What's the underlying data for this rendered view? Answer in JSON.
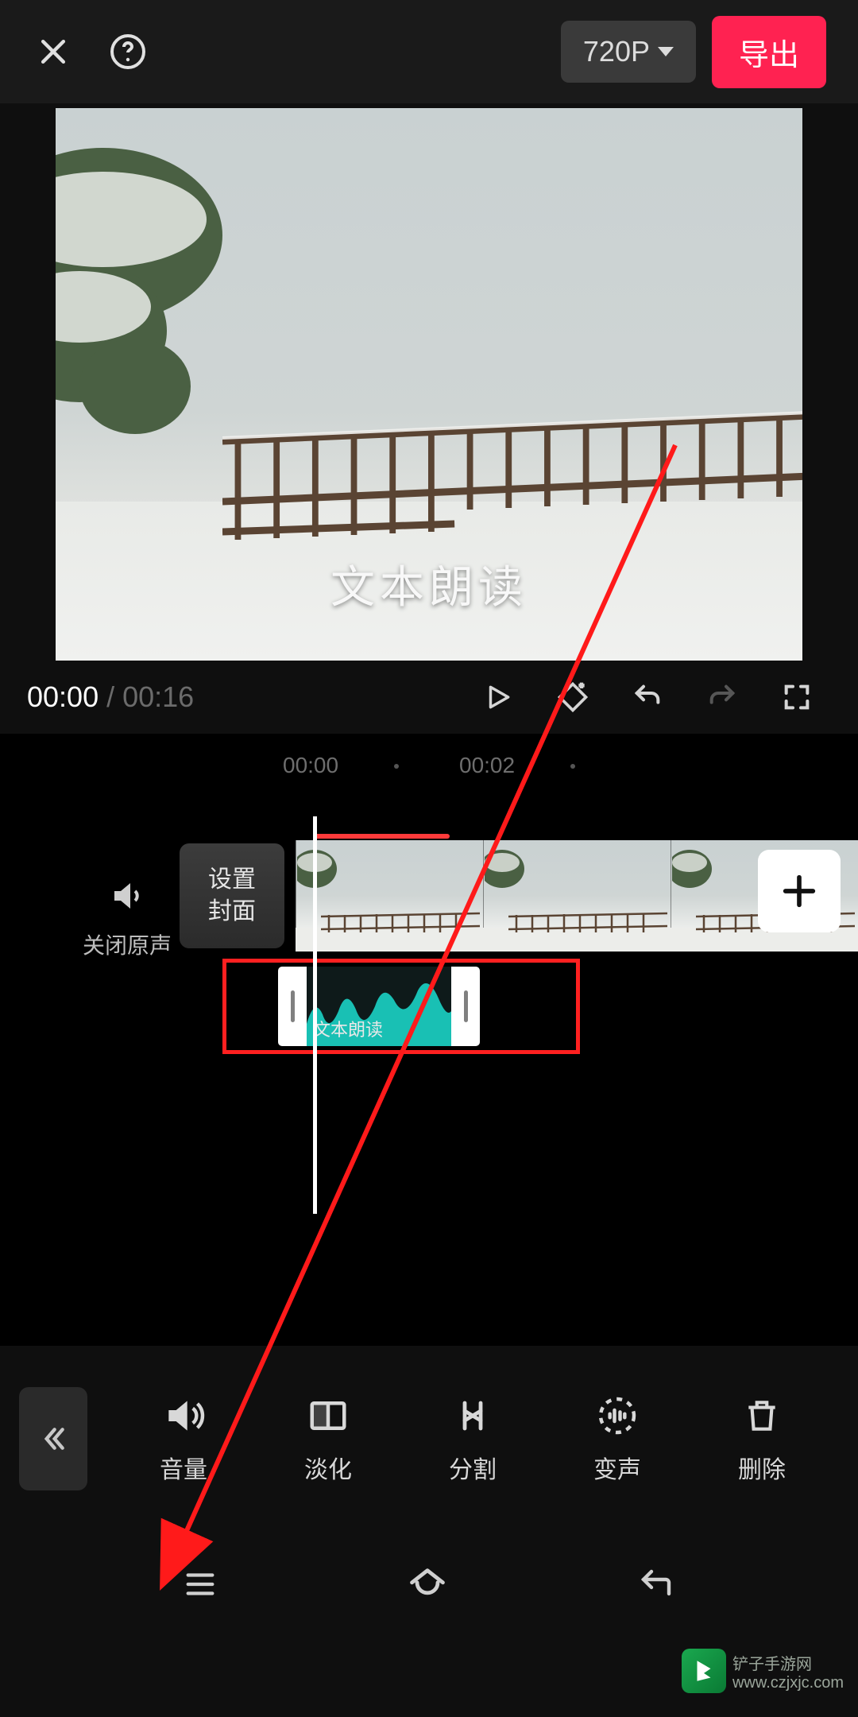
{
  "header": {
    "resolution": "720P",
    "export_label": "导出"
  },
  "preview": {
    "subtitle": "文本朗读"
  },
  "playbar": {
    "current_time": "00:00",
    "duration": "00:16"
  },
  "ruler": {
    "t0": "00:00",
    "t1": "00:02"
  },
  "tracks": {
    "mute_label": "关闭原声",
    "cover_button": "设置\n封面",
    "audio_clip_label": "文本朗读"
  },
  "tools": [
    {
      "id": "volume",
      "label": "音量"
    },
    {
      "id": "fade",
      "label": "淡化"
    },
    {
      "id": "split",
      "label": "分割"
    },
    {
      "id": "voice-change",
      "label": "变声"
    },
    {
      "id": "delete",
      "label": "删除"
    }
  ],
  "watermark": {
    "site_line1": "铲子手游网",
    "site_line2": "www.czjxjc.com"
  },
  "colors": {
    "accent_red": "#ff2251",
    "annotation_red": "#ff2020",
    "wave_teal": "#19c0b4"
  }
}
